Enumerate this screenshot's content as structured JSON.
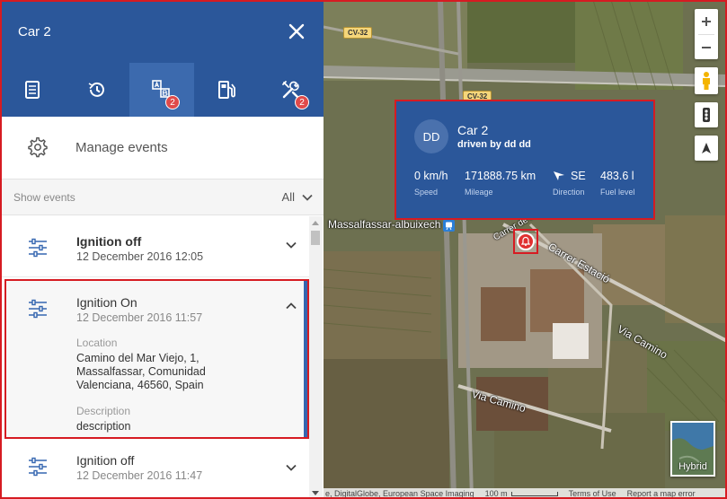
{
  "panel": {
    "title": "Car 2",
    "tabs": [
      {
        "name": "details",
        "icon": "document-icon",
        "badge": ""
      },
      {
        "name": "history",
        "icon": "history-icon",
        "badge": ""
      },
      {
        "name": "events",
        "icon": "events-icon",
        "badge": "2",
        "active": true
      },
      {
        "name": "fuel",
        "icon": "fuel-icon",
        "badge": ""
      },
      {
        "name": "service",
        "icon": "tools-icon",
        "badge": "2"
      }
    ],
    "manage_events_label": "Manage events",
    "show_events_label": "Show events",
    "filter_value": "All"
  },
  "events": [
    {
      "title": "Ignition off",
      "time": "12 December 2016 12:05"
    },
    {
      "title": "Ignition On",
      "time": "12 December 2016 11:57",
      "location_label": "Location",
      "location_value": "Camino del Mar Viejo, 1, Massalfassar, Comunidad Valenciana, 46560, Spain",
      "description_label": "Description",
      "description_value": "description"
    },
    {
      "title": "Ignition off",
      "time": "12 December 2016 11:47"
    }
  ],
  "map": {
    "labels": {
      "road_cv32_a": "CV-32",
      "road_cv32_b": "CV-32",
      "station": "Massalfassar-albuixech",
      "street_estacio": "Carrer Estació",
      "via_camino_1": "Via Camino",
      "via_camino_2": "Via Camino",
      "street_partial": "Carrer de l'Es"
    },
    "hybrid_label": "Hybrid",
    "attribution": {
      "imagery": "e, DigitalGlobe, European Space Imaging",
      "scale": "100 m",
      "terms": "Terms of Use",
      "report": "Report a map error"
    }
  },
  "vehicle_card": {
    "avatar_initials": "DD",
    "title": "Car 2",
    "subtitle": "driven by dd dd",
    "stats": {
      "speed_value": "0 km/h",
      "speed_label": "Speed",
      "mileage_value": "171888.75 km",
      "mileage_label": "Mileage",
      "direction_value": "SE",
      "direction_label": "Direction",
      "fuel_value": "483.6 l",
      "fuel_label": "Fuel level"
    }
  },
  "colors": {
    "header_blue": "#2b579a",
    "active_tab": "#3c6aae",
    "highlight_red": "#d61b22",
    "badge_red": "#e04a4a"
  }
}
